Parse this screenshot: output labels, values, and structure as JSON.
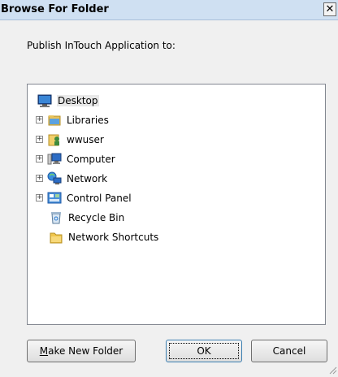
{
  "window": {
    "title": "Browse For Folder",
    "close_glyph": "✕"
  },
  "prompt": "Publish InTouch Application to:",
  "tree": {
    "items": [
      {
        "label": "Desktop",
        "icon": "desktop-icon",
        "expandable": false,
        "selected": true
      },
      {
        "label": "Libraries",
        "icon": "libraries-icon",
        "expandable": true
      },
      {
        "label": "wwuser",
        "icon": "user-folder-icon",
        "expandable": true
      },
      {
        "label": "Computer",
        "icon": "computer-icon",
        "expandable": true
      },
      {
        "label": "Network",
        "icon": "network-icon",
        "expandable": true
      },
      {
        "label": "Control Panel",
        "icon": "control-panel-icon",
        "expandable": true
      },
      {
        "label": "Recycle Bin",
        "icon": "recycle-bin-icon",
        "expandable": false
      },
      {
        "label": "Network Shortcuts",
        "icon": "folder-icon",
        "expandable": false
      }
    ]
  },
  "buttons": {
    "make_new_folder_accel": "M",
    "make_new_folder_rest": "ake New Folder",
    "ok": "OK",
    "cancel": "Cancel"
  },
  "colors": {
    "titlebar": "#cfe0f2",
    "dialog_bg": "#f0f0f0",
    "tree_border": "#828790"
  }
}
